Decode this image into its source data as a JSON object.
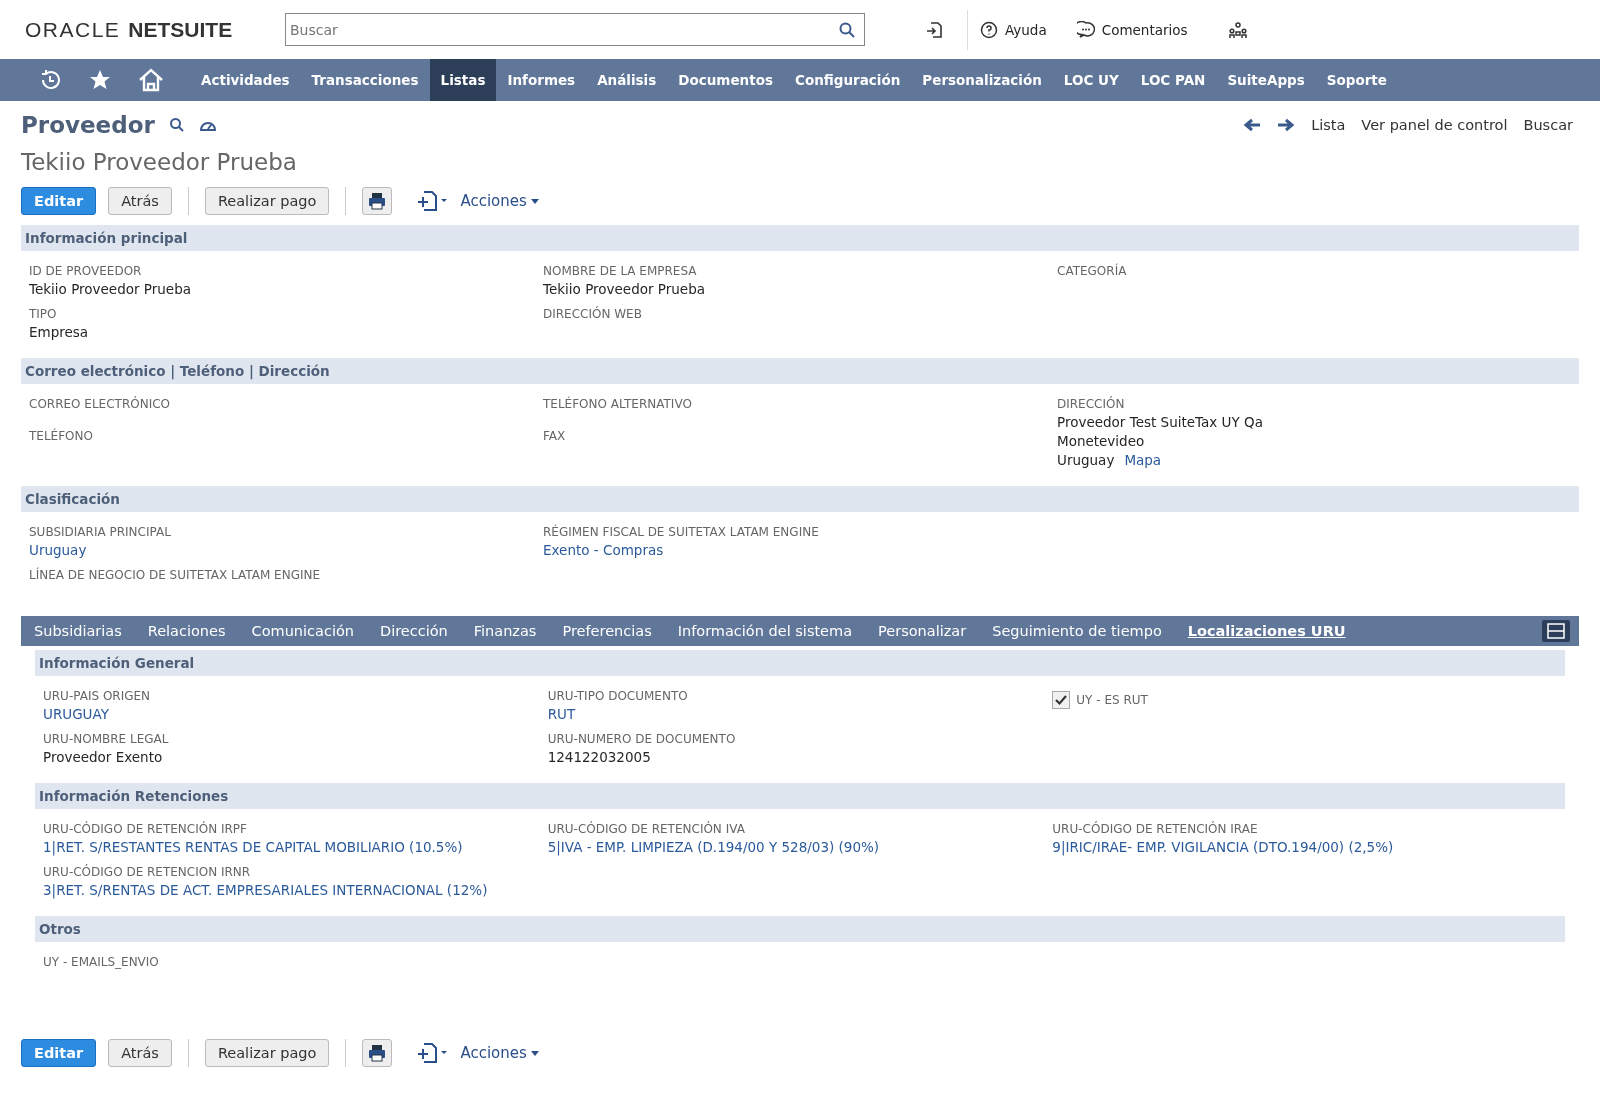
{
  "header": {
    "logo_oracle": "ORACLE",
    "logo_netsuite": "NETSUITE",
    "search": {
      "placeholder": "Buscar"
    },
    "links": [
      {
        "kind": "help",
        "label": "Ayuda"
      },
      {
        "kind": "feedback",
        "label": "Comentarios"
      }
    ]
  },
  "nav": [
    {
      "label": "Actividades",
      "selected": false
    },
    {
      "label": "Transacciones",
      "selected": false
    },
    {
      "label": "Listas",
      "selected": true
    },
    {
      "label": "Informes",
      "selected": false
    },
    {
      "label": "Análisis",
      "selected": false
    },
    {
      "label": "Documentos",
      "selected": false
    },
    {
      "label": "Configuración",
      "selected": false
    },
    {
      "label": "Personalización",
      "selected": false
    },
    {
      "label": "LOC UY",
      "selected": false
    },
    {
      "label": "LOC PAN",
      "selected": false
    },
    {
      "label": "SuiteApps",
      "selected": false
    },
    {
      "label": "Soporte",
      "selected": false
    }
  ],
  "page": {
    "type": "Proveedor",
    "title": "Tekiio Proveedor Prueba",
    "right_links": [
      "Lista",
      "Ver panel de control",
      "Buscar"
    ]
  },
  "toolbars": [
    {
      "edit": "Editar",
      "back": "Atrás",
      "pay": "Realizar pago",
      "actions": "Acciones"
    },
    {
      "edit": "Editar",
      "back": "Atrás",
      "pay": "Realizar pago",
      "actions": "Acciones"
    }
  ],
  "sections": [
    {
      "title": "Información principal",
      "columns": [
        [
          {
            "label": "ID DE PROVEEDOR",
            "lines": [
              [
                {
                  "text": "Tekiio Proveedor Prueba",
                  "link": false
                }
              ]
            ]
          },
          {
            "label": "TIPO",
            "lines": [
              [
                {
                  "text": "Empresa",
                  "link": false
                }
              ]
            ]
          }
        ],
        [
          {
            "label": "NOMBRE DE LA EMPRESA",
            "lines": [
              [
                {
                  "text": "Tekiio Proveedor Prueba",
                  "link": false
                }
              ]
            ]
          },
          {
            "label": "DIRECCIÓN WEB"
          }
        ],
        [
          {
            "label": "CATEGORÍA"
          }
        ]
      ]
    },
    {
      "title": "Correo electrónico | Teléfono | Dirección",
      "columns": [
        [
          {
            "label": "CORREO ELECTRÓNICO"
          },
          {
            "label": "TELÉFONO"
          }
        ],
        [
          {
            "label": "TELÉFONO ALTERNATIVO"
          },
          {
            "label": "FAX"
          }
        ],
        [
          {
            "label": "DIRECCIÓN",
            "lines": [
              [
                {
                  "text": "Proveedor Test SuiteTax UY Qa",
                  "link": false
                }
              ],
              [
                {
                  "text": "Monetevideo",
                  "link": false
                }
              ],
              [
                {
                  "text": "Uruguay",
                  "link": false
                },
                {
                  "text": "Mapa",
                  "link": true
                }
              ]
            ]
          }
        ]
      ]
    },
    {
      "title": "Clasificación",
      "columns": [
        [
          {
            "label": "SUBSIDIARIA PRINCIPAL",
            "lines": [
              [
                {
                  "text": "Uruguay",
                  "link": true
                }
              ]
            ]
          },
          {
            "label": "LÍNEA DE NEGOCIO DE SUITETAX LATAM ENGINE"
          }
        ],
        [
          {
            "label": "RÉGIMEN FISCAL DE SUITETAX LATAM ENGINE",
            "lines": [
              [
                {
                  "text": "Exento - Compras",
                  "link": true
                }
              ]
            ]
          }
        ],
        []
      ]
    }
  ],
  "subtabs": [
    {
      "label": "Subsidiarias",
      "selected": false
    },
    {
      "label": "Relaciones",
      "selected": false
    },
    {
      "label": "Comunicación",
      "selected": false
    },
    {
      "label": "Dirección",
      "selected": false
    },
    {
      "label": "Finanzas",
      "selected": false
    },
    {
      "label": "Preferencias",
      "selected": false
    },
    {
      "label": "Información del sistema",
      "selected": false
    },
    {
      "label": "Personalizar",
      "selected": false
    },
    {
      "label": "Seguimiento de tiempo",
      "selected": false
    },
    {
      "label": "Localizaciones URU",
      "selected": true
    }
  ],
  "subtab_sections": [
    {
      "title": "Información General",
      "columns": [
        [
          {
            "label": "URU-PAIS ORIGEN",
            "lines": [
              [
                {
                  "text": "URUGUAY",
                  "link": true
                }
              ]
            ]
          },
          {
            "label": "URU-NOMBRE LEGAL",
            "lines": [
              [
                {
                  "text": "Proveedor Exento",
                  "link": false
                }
              ]
            ]
          }
        ],
        [
          {
            "label": "URU-TIPO DOCUMENTO",
            "lines": [
              [
                {
                  "text": "RUT",
                  "link": true
                }
              ]
            ]
          },
          {
            "label": "URU-NUMERO DE DOCUMENTO",
            "lines": [
              [
                {
                  "text": "124122032005",
                  "link": false
                }
              ]
            ]
          }
        ],
        [
          {
            "kind": "checkbox",
            "label": "UY - ES RUT",
            "checked": true
          }
        ]
      ]
    },
    {
      "title": "Información Retenciones",
      "columns": [
        [
          {
            "label": "URU-CÓDIGO DE RETENCIÓN IRPF",
            "lines": [
              [
                {
                  "text": "1|RET. S/RESTANTES RENTAS DE CAPITAL MOBILIARIO (10.5%)",
                  "link": true
                }
              ]
            ]
          },
          {
            "label": "URU-CÓDIGO DE RETENCION IRNR",
            "lines": [
              [
                {
                  "text": "3|RET. S/RENTAS DE ACT. EMPRESARIALES INTERNACIONAL (12%)",
                  "link": true
                }
              ]
            ]
          }
        ],
        [
          {
            "label": "URU-CÓDIGO DE RETENCIÓN IVA",
            "lines": [
              [
                {
                  "text": "5|IVA - EMP. LIMPIEZA (D.194/00 Y 528/03) (90%)",
                  "link": true
                }
              ]
            ]
          }
        ],
        [
          {
            "label": "URU-CÓDIGO DE RETENCIÓN IRAE",
            "lines": [
              [
                {
                  "text": "9|IRIC/IRAE- EMP. VIGILANCIA (DTO.194/00) (2,5%)",
                  "link": true
                }
              ]
            ]
          }
        ]
      ]
    },
    {
      "title": "Otros",
      "columns": [
        [
          {
            "label": "UY - EMAILS_ENVIO"
          }
        ],
        [],
        []
      ]
    }
  ]
}
